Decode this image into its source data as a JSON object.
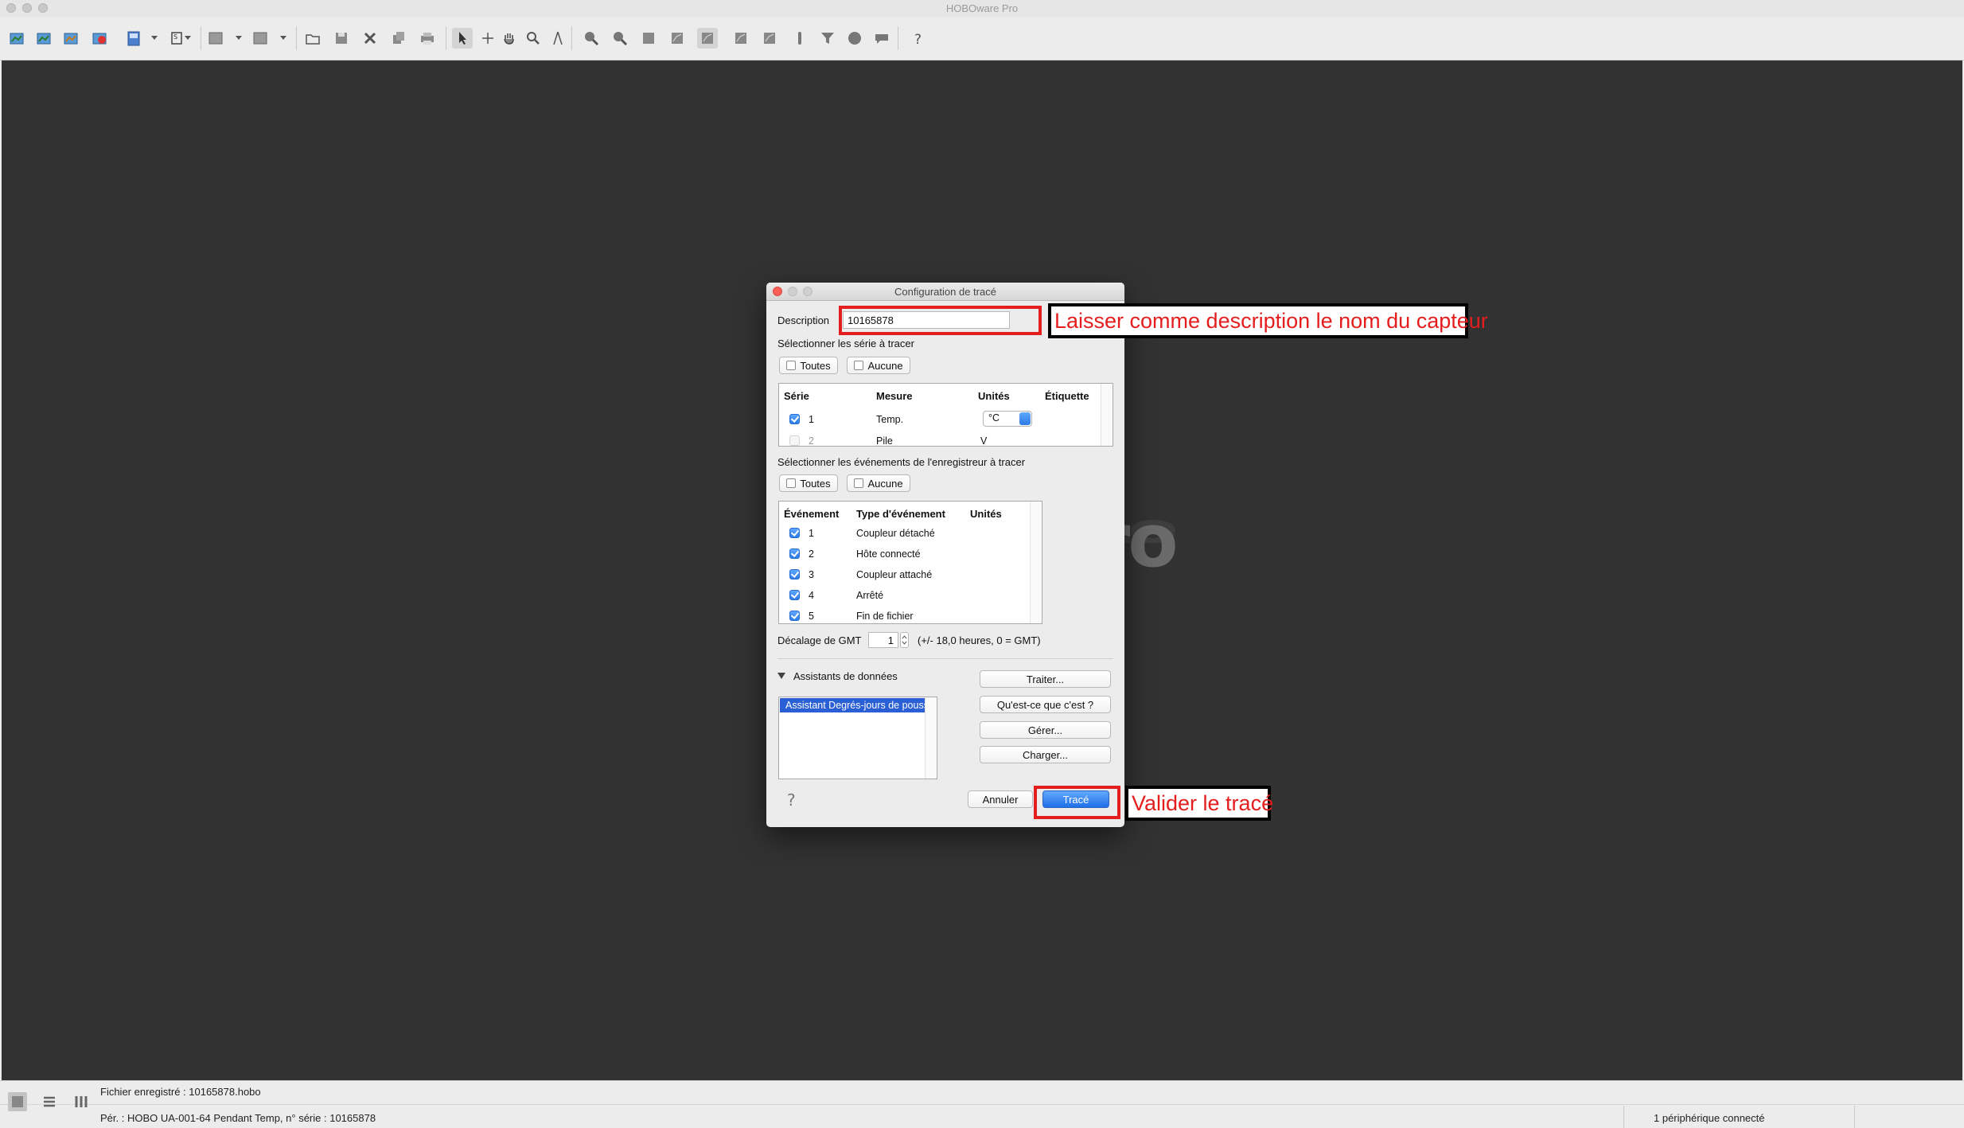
{
  "window": {
    "title": "HOBOware Pro"
  },
  "workspace": {
    "watermark": "ro"
  },
  "dialog": {
    "title": "Configuration de tracé",
    "description_label": "Description",
    "description_value": "10165878",
    "series_section_label": "Sélectionner les série à tracer",
    "all_label": "Toutes",
    "none_label": "Aucune",
    "series_table": {
      "headers": [
        "Série",
        "Mesure",
        "Unités",
        "Étiquette"
      ],
      "rows": [
        {
          "num": "1",
          "measure": "Temp.",
          "unit": "°C",
          "checked": true
        },
        {
          "num": "2",
          "measure": "Pile",
          "unit": "V",
          "checked": false
        }
      ]
    },
    "events_section_label": "Sélectionner les événements de l'enregistreur à tracer",
    "events_table": {
      "headers": [
        "Événement",
        "Type d'événement",
        "Unités"
      ],
      "rows": [
        {
          "num": "1",
          "type": "Coupleur détaché",
          "checked": true
        },
        {
          "num": "2",
          "type": "Hôte connecté",
          "checked": true
        },
        {
          "num": "3",
          "type": "Coupleur attaché",
          "checked": true
        },
        {
          "num": "4",
          "type": "Arrêté",
          "checked": true
        },
        {
          "num": "5",
          "type": "Fin de fichier",
          "checked": true
        }
      ]
    },
    "gmt_label": "Décalage de GMT",
    "gmt_value": "1",
    "gmt_hint": "(+/- 18,0 heures, 0 = GMT)",
    "assistants_label": "Assistants de données",
    "assistants": [
      "Assistant Degrés-jours de pousse"
    ],
    "process_button": "Traiter...",
    "whatis_button": "Qu'est-ce que c'est ?",
    "manage_button": "Gérer...",
    "load_button": "Charger...",
    "cancel_button": "Annuler",
    "plot_button": "Tracé",
    "help_glyph": "?"
  },
  "annotations": {
    "description_note": "Laisser comme description le nom du capteur",
    "plot_note": "Valider le tracé"
  },
  "status": {
    "saved_file": "Fichier enregistré : 10165878.hobo",
    "device_info": "Pér. : HOBO UA-001-64 Pendant Temp, n° série : 10165878",
    "connected": "1 périphérique connecté"
  },
  "colors": {
    "annotation_red": "#e41e1e",
    "workspace": "#323232",
    "accent_blue": "#2b7be8"
  }
}
